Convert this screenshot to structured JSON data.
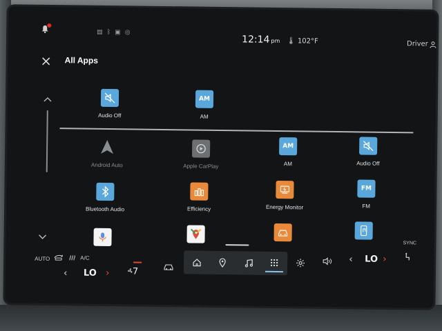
{
  "status": {
    "time": "12:14",
    "ampm": "pm",
    "temperature": "102°F",
    "profile": "Driver",
    "notification_color": "#e02b2b"
  },
  "header": {
    "title": "All Apps"
  },
  "favorites": [
    {
      "label": "Audio Off",
      "icon": "speaker-mute-icon",
      "color": "#5aa7dc"
    },
    {
      "label": "AM",
      "icon": "am-radio-icon",
      "color": "#5aa7dc"
    }
  ],
  "apps": [
    {
      "label": "Android Auto",
      "icon": "android-auto-icon",
      "enabled": false
    },
    {
      "label": "Apple CarPlay",
      "icon": "carplay-icon",
      "enabled": false
    },
    {
      "label": "AM",
      "icon": "am-radio-icon",
      "enabled": true
    },
    {
      "label": "Audio Off",
      "icon": "speaker-mute-icon",
      "enabled": true
    },
    {
      "label": "Bluetooth Audio",
      "icon": "bluetooth-icon",
      "enabled": true
    },
    {
      "label": "Efficiency",
      "icon": "efficiency-icon",
      "enabled": true
    },
    {
      "label": "Energy Monitor",
      "icon": "energy-monitor-icon",
      "enabled": true
    },
    {
      "label": "FM",
      "icon": "fm-radio-icon",
      "enabled": true
    },
    {
      "label": "",
      "icon": "microphone-icon",
      "enabled": true
    },
    {
      "label": "",
      "icon": "google-maps-icon",
      "enabled": true
    },
    {
      "label": "",
      "icon": "vehicle-icon",
      "enabled": true
    },
    {
      "label": "",
      "icon": "phone-media-icon",
      "enabled": true
    }
  ],
  "climate": {
    "auto": "AUTO",
    "ac": "A/C",
    "left_temp": "LO",
    "fan_speed": "7",
    "right_temp": "LO",
    "sync": "SYNC",
    "accent": "#e6453f"
  },
  "dock": [
    {
      "icon": "home-icon"
    },
    {
      "icon": "navigation-pin-icon"
    },
    {
      "icon": "music-note-icon"
    },
    {
      "icon": "app-grid-icon",
      "active": true
    }
  ]
}
